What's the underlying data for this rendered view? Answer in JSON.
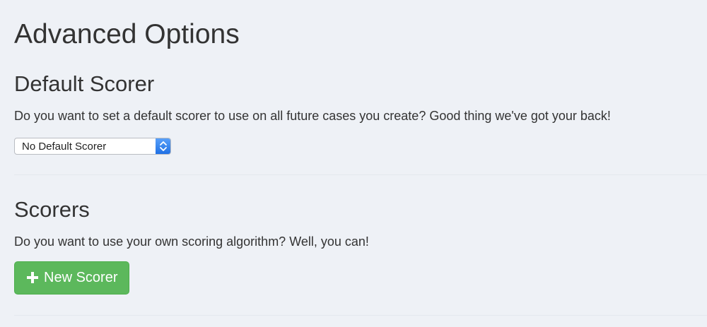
{
  "page": {
    "title": "Advanced Options"
  },
  "default_scorer": {
    "heading": "Default Scorer",
    "description": "Do you want to set a default scorer to use on all future cases you create? Good thing we've got your back!",
    "select": {
      "selected_value": "No Default Scorer",
      "stepper_icon": "updown-chevron-icon"
    }
  },
  "scorers": {
    "heading": "Scorers",
    "description": "Do you want to use your own scoring algorithm? Well, you can!",
    "new_button": {
      "label": "New Scorer",
      "icon": "plus-icon"
    }
  },
  "colors": {
    "background": "#eef1f6",
    "text": "#333333",
    "button_green": "#5cb85c",
    "select_accent": "#2e7bf0"
  }
}
